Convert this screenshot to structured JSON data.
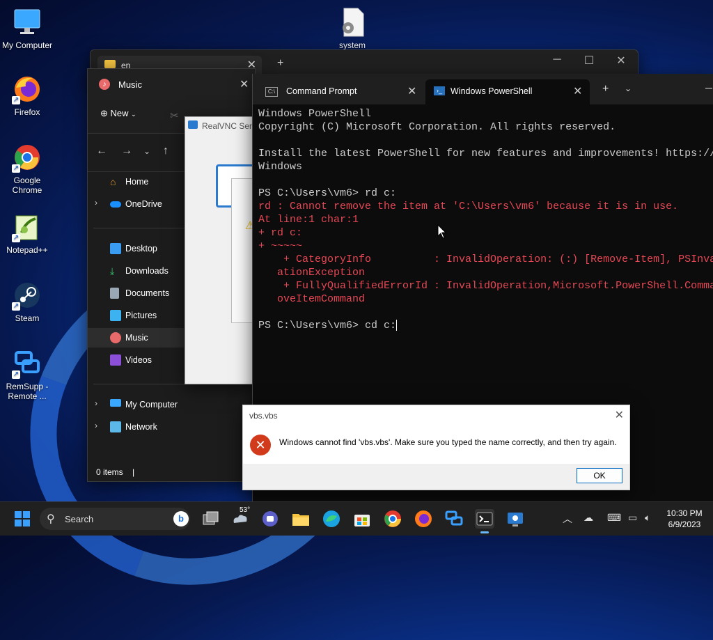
{
  "desktop": {
    "icons": [
      {
        "label": "My Computer"
      },
      {
        "label": "system"
      },
      {
        "label": "Firefox"
      },
      {
        "label": "Google Chrome"
      },
      {
        "label": "Notepad++"
      },
      {
        "label": "Steam"
      },
      {
        "label": "RemSupp - Remote ..."
      }
    ]
  },
  "explorer_back": {
    "tab_title": "en",
    "tab_close": "✕",
    "new_tab": "+"
  },
  "music_window": {
    "title": "Music",
    "close": "✕",
    "new_button": "New",
    "nav_items": [
      {
        "label": "Home"
      },
      {
        "label": "OneDrive"
      },
      {
        "label": "Desktop"
      },
      {
        "label": "Downloads"
      },
      {
        "label": "Documents"
      },
      {
        "label": "Pictures"
      },
      {
        "label": "Music"
      },
      {
        "label": "Videos"
      },
      {
        "label": "My Computer"
      },
      {
        "label": "Network"
      }
    ],
    "status": "0 items"
  },
  "vnc": {
    "title": "RealVNC Serv"
  },
  "terminal": {
    "tabs": [
      {
        "label": "Command Prompt"
      },
      {
        "label": "Windows PowerShell"
      }
    ],
    "lines": [
      "Windows PowerShell",
      "Copyright (C) Microsoft Corporation. All rights reserved.",
      "",
      "Install the latest PowerShell for new features and improvements! https://",
      "Windows",
      "",
      "PS C:\\Users\\vm6> rd c:",
      "rd : Cannot remove the item at 'C:\\Users\\vm6' because it is in use.",
      "At line:1 char:1",
      "+ rd c:",
      "+ ~~~~~",
      "    + CategoryInfo          : InvalidOperation: (:) [Remove-Item], PSInva",
      "   ationException",
      "    + FullyQualifiedErrorId : InvalidOperation,Microsoft.PowerShell.Comma",
      "   oveItemCommand",
      "",
      "PS C:\\Users\\vm6> cd c:"
    ]
  },
  "dialog": {
    "title": "vbs.vbs",
    "message": "Windows cannot find 'vbs.vbs'. Make sure you typed the name correctly, and then try again.",
    "ok": "OK"
  },
  "taskbar": {
    "search": "Search",
    "weather": "53°",
    "time": "10:30 PM",
    "date": "6/9/2023"
  },
  "colors": {
    "error_red": "#e74856",
    "terminal_bg": "#0c0c0c",
    "accent": "#0067c0"
  }
}
